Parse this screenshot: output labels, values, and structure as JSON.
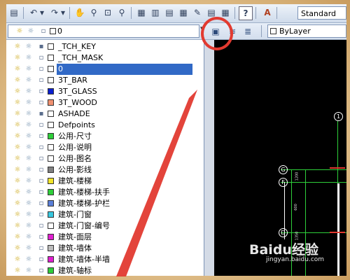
{
  "toolbar": {
    "style_value": "Standard"
  },
  "layer_bar": {
    "current_layer": "0",
    "color_value": "ByLayer"
  },
  "layers": [
    {
      "name": "_TCH_KEY",
      "color": "#ffffff",
      "locked": true
    },
    {
      "name": "_TCH_MASK",
      "color": "#ffffff",
      "locked": false
    },
    {
      "name": "0",
      "color": "#ffffff",
      "locked": false,
      "selected": true
    },
    {
      "name": "3T_BAR",
      "color": "#ffffff",
      "locked": false
    },
    {
      "name": "3T_GLASS",
      "color": "#0a1fd0",
      "locked": false
    },
    {
      "name": "3T_WOOD",
      "color": "#f09070",
      "locked": false
    },
    {
      "name": "ASHADE",
      "color": "#ffffff",
      "locked": true
    },
    {
      "name": "Defpoints",
      "color": "#ffffff",
      "locked": false
    },
    {
      "name": "公用-尺寸",
      "color": "#2ecf3a",
      "locked": false
    },
    {
      "name": "公用-说明",
      "color": "#ffffff",
      "locked": false
    },
    {
      "name": "公用-图名",
      "color": "#ffffff",
      "locked": false
    },
    {
      "name": "公用-影线",
      "color": "#808080",
      "locked": false
    },
    {
      "name": "建筑-楼梯",
      "color": "#f2e52a",
      "locked": false
    },
    {
      "name": "建筑-楼梯-扶手",
      "color": "#2ecf3a",
      "locked": false
    },
    {
      "name": "建筑-楼梯-护栏",
      "color": "#5a7fd8",
      "locked": false
    },
    {
      "name": "建筑-门窗",
      "color": "#38c8e0",
      "locked": false
    },
    {
      "name": "建筑-门窗-编号",
      "color": "#ffffff",
      "locked": false
    },
    {
      "name": "建筑-面层",
      "color": "#e020d0",
      "locked": false
    },
    {
      "name": "建筑-墙体",
      "color": "#bcbcbc",
      "locked": false
    },
    {
      "name": "建筑-墙体-半墙",
      "color": "#e020d0",
      "locked": false
    },
    {
      "name": "建筑-轴标",
      "color": "#2ecf3a",
      "locked": false
    }
  ],
  "drawing": {
    "axis_labels": [
      "1",
      "G",
      "F",
      "D"
    ],
    "dims": [
      "1200",
      "600",
      "1350"
    ]
  },
  "watermark": {
    "brand": "Baidu经验",
    "url": "jingyan.baidu.com"
  },
  "colors": {
    "annotation_red": "#e23a30",
    "selection_blue": "#3169c6"
  }
}
